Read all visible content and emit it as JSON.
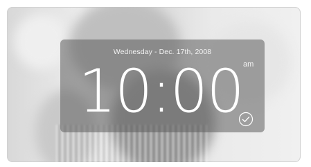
{
  "clock": {
    "date": "Wednesday - Dec. 17th, 2008",
    "time": "10:00",
    "period": "am",
    "confirm_icon": "check-circle-icon"
  },
  "colors": {
    "panel": "#5f5f5f",
    "text": "#ffffff"
  }
}
